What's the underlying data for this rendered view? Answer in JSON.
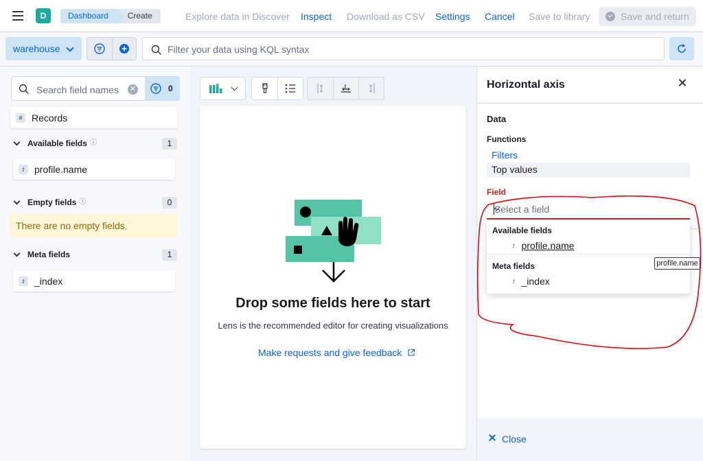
{
  "header": {
    "app_initial": "D",
    "breadcrumbs": [
      "Dashboard",
      "Create"
    ],
    "links": {
      "explore": "Explore data in Discover",
      "inspect": "Inspect",
      "download": "Download as CSV",
      "settings": "Settings",
      "cancel": "Cancel",
      "save_library": "Save to library",
      "save_return": "Save and return"
    }
  },
  "query": {
    "data_view": "warehouse",
    "placeholder": "Filter your data using KQL syntax"
  },
  "field_list": {
    "search_placeholder": "Search field names",
    "filter_count": "0",
    "records": "Records",
    "records_type": "#",
    "sections": [
      {
        "title": "Available fields",
        "count": "1",
        "fields": [
          "profile.name"
        ]
      },
      {
        "title": "Empty fields",
        "count": "0",
        "empty_message": "There are no empty fields."
      },
      {
        "title": "Meta fields",
        "count": "1",
        "fields": [
          "_index"
        ]
      }
    ],
    "field_type_glyph": "t"
  },
  "workspace": {
    "drop_title": "Drop some fields here to start",
    "drop_subtitle": "Lens is the recommended editor for creating visualizations",
    "feedback_link": "Make requests and give feedback"
  },
  "flyout": {
    "title": "Horizontal axis",
    "data_label": "Data",
    "functions_label": "Functions",
    "functions": [
      "Filters",
      "Top values"
    ],
    "field_label": "Field",
    "field_placeholder": "Select a field",
    "dropdown": {
      "groups": [
        {
          "title": "Available fields",
          "items": [
            "profile.name"
          ]
        },
        {
          "title": "Meta fields",
          "items": [
            "_index"
          ]
        }
      ]
    },
    "close_label": "Close"
  },
  "tooltip": "profile.name",
  "colors": {
    "accent": "#0b64dd",
    "brand_avatar": "#1ba9a0",
    "invalid": "#bd271e",
    "annotation": "#e8000b"
  }
}
